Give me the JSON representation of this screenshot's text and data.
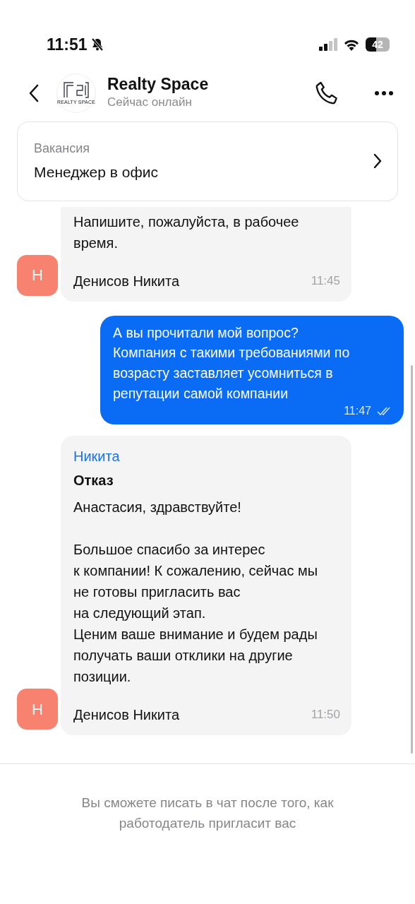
{
  "status_bar": {
    "time": "11:51",
    "battery": "42"
  },
  "header": {
    "logo_text": "REALTY SPACE",
    "title": "Realty Space",
    "subtitle": "Сейчас онлайн"
  },
  "vacancy": {
    "label": "Вакансия",
    "title": "Менеджер в офис"
  },
  "messages": [
    {
      "kind": "incoming",
      "avatar": "Н",
      "text": "Напишите, пожалуйста, в рабочее\nвремя.",
      "author": "Денисов Никита",
      "time": "11:45"
    },
    {
      "kind": "outgoing",
      "text": "А вы прочитали мой вопрос?\nКомпания с такими требованиями по\nвозрасту заставляет усомниться в\nрепутации самой компании",
      "time": "11:47",
      "read": true
    },
    {
      "kind": "incoming",
      "avatar": "Н",
      "sender": "Никита",
      "title": "Отказ",
      "text": "Анастасия, здравствуйте!\n\nБольшое спасибо за интерес\nк компании! К сожалению, сейчас мы\nне готовы пригласить вас\nна следующий этап.\nЦеним ваше внимание и будем рады\nполучать ваши отклики на другие\nпозиции.",
      "author": "Денисов Никита",
      "time": "11:50"
    }
  ],
  "footer": {
    "notice": "Вы сможете писать в чат после того, как работодатель пригласит вас"
  }
}
